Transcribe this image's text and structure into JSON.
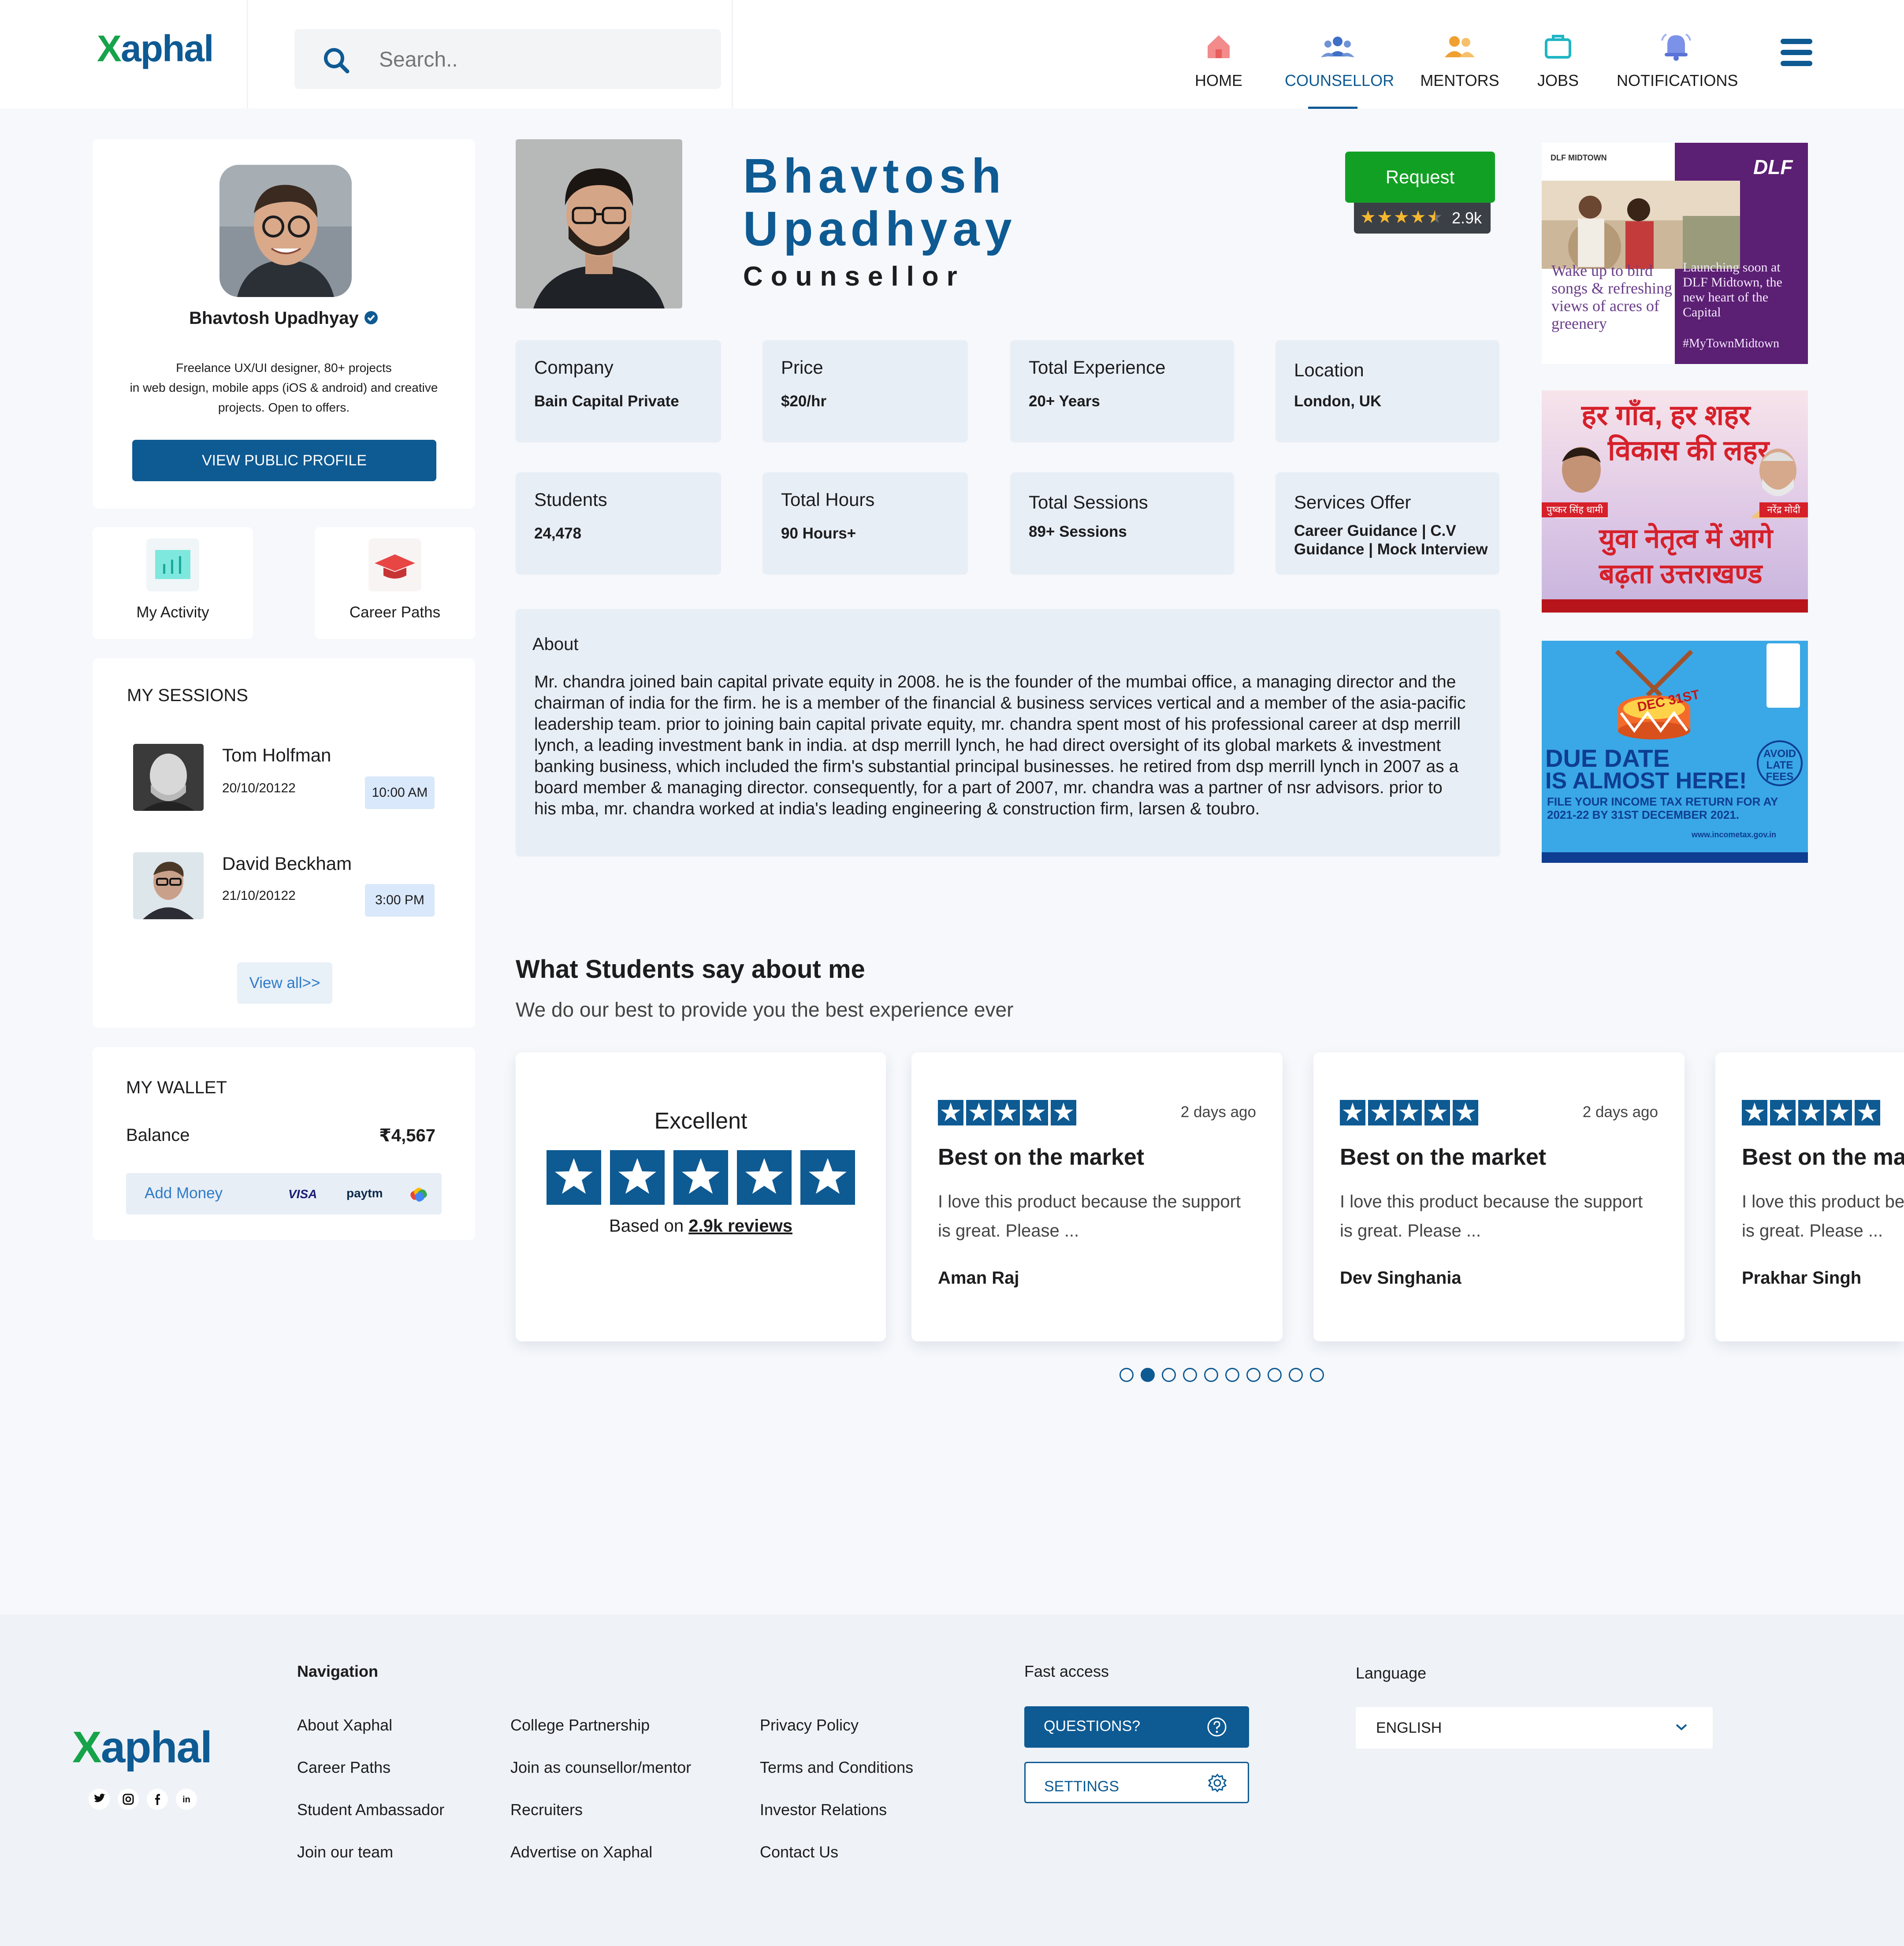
{
  "header": {
    "logo": {
      "x": "X",
      "rest": "aphal"
    },
    "search_placeholder": "Search..",
    "nav": [
      {
        "label": "HOME",
        "icon": "home-icon"
      },
      {
        "label": "COUNSELLOR",
        "icon": "counsellor-icon",
        "active": true
      },
      {
        "label": "MENTORS",
        "icon": "mentors-icon"
      },
      {
        "label": "JOBS",
        "icon": "jobs-icon"
      },
      {
        "label": "NOTIFICATIONS",
        "icon": "notifications-icon"
      }
    ],
    "menu_icon": "hamburger-menu-icon"
  },
  "sidebar": {
    "profile": {
      "name": "Bhavtosh Upadhyay",
      "bio_line1": "Freelance UX/UI designer, 80+ projects",
      "bio_line2": "in web design, mobile apps (iOS & android) and creative",
      "bio_line3": "projects. Open to offers.",
      "view_button": "VIEW PUBLIC PROFILE"
    },
    "tiles": [
      {
        "label": "My Activity",
        "icon": "activity-chart-icon"
      },
      {
        "label": "Career Paths",
        "icon": "graduation-cap-icon"
      }
    ],
    "sessions": {
      "title": "MY SESSIONS",
      "items": [
        {
          "name": "Tom Holfman",
          "date": "20/10/20122",
          "time": "10:00 AM"
        },
        {
          "name": "David Beckham",
          "date": "21/10/20122",
          "time": "3:00 PM"
        }
      ],
      "view_all": "View all>>"
    },
    "wallet": {
      "title": "MY WALLET",
      "balance_label": "Balance",
      "balance_value": "₹4,567",
      "add_money": "Add Money",
      "payment_logos": [
        "VISA",
        "paytm"
      ]
    }
  },
  "profile": {
    "first_name": "Bhavtosh",
    "last_name": "Upadhyay",
    "role": "Counsellor",
    "request_button": "Request",
    "rating_count": "2.9k",
    "rating_stars": 4.5,
    "info": [
      {
        "label": "Company",
        "value": "Bain Capital Private"
      },
      {
        "label": "Price",
        "value": "$20/hr"
      },
      {
        "label": "Total Experience",
        "value": "20+ Years"
      },
      {
        "label": "Location",
        "value": "London, UK"
      },
      {
        "label": "Students",
        "value": "24,478"
      },
      {
        "label": "Total Hours",
        "value": "90 Hours+"
      },
      {
        "label": "Total Sessions",
        "value": "89+ Sessions"
      },
      {
        "label": "Services Offer",
        "value": "Career Guidance | C.V Guidance | Mock Interview"
      }
    ],
    "about_title": "About",
    "about_text": "Mr. chandra joined bain capital private equity in 2008. he is the founder of the mumbai office, a managing director and the chairman of india for the firm. he is a member of the financial & business services vertical and a member of the asia-pacific leadership team. prior to joining bain capital private equity, mr. chandra spent most of his professional career at dsp merrill lynch, a leading investment bank in india. at dsp merrill lynch, he had direct oversight of its global markets & investment banking business, which included the firm's substantial principal businesses. he retired from dsp merrill lynch in 2007 as a board member & managing director. consequently, for a part of 2007, mr. chandra was a partner of nsr advisors. prior to his mba, mr. chandra worked at india's leading engineering & construction firm, larsen & toubro."
  },
  "ads": [
    {
      "brand_small": "DLF MIDTOWN",
      "brand": "DLF",
      "left_text": "Wake up to bird songs & refreshing views of acres of greenery",
      "right_text": "Launching soon at DLF Midtown, the new heart of the Capital",
      "tag": "#MyTownMidtown"
    },
    {
      "headline1": "हर गाँव, हर शहर",
      "headline2": "विकास की लहर",
      "person1": "पुष्कर सिंह धामी",
      "person2": "नरेंद्र मोदी",
      "slogan1": "युवा नेतृत्व में आगे",
      "slogan2": "बढ़ता उत्तराखण्ड"
    },
    {
      "date_badge": "DEC 31ST",
      "headline1": "DUE DATE",
      "headline2": "IS ALMOST HERE!",
      "avoid": "AVOID LATE FEES",
      "subline": "FILE YOUR INCOME TAX RETURN FOR AY 2021-22 BY 31ST DECEMBER 2021.",
      "site": "www.incometax.gov.in"
    }
  ],
  "reviews": {
    "title": "What Students say about me",
    "subtitle": "We do our best to provide you the best experience ever",
    "summary": {
      "label": "Excellent",
      "based_on": "Based on",
      "reviews_link": "2.9k reviews",
      "stars": 5
    },
    "items": [
      {
        "time": "2 days ago",
        "title": "Best on the market",
        "text1": "I love this product because the support",
        "text2": "is great. Please ...",
        "author": "Aman Raj",
        "stars": 5
      },
      {
        "time": "2 days ago",
        "title": "Best on the market",
        "text1": "I love this product because the support",
        "text2": "is great. Please ...",
        "author": "Dev Singhania",
        "stars": 5
      },
      {
        "time": "",
        "title": "Best on the market",
        "text1": "I love this product because the support",
        "text2": "is great. Please ...",
        "author": "Prakhar Singh",
        "stars": 5
      }
    ],
    "pagination": {
      "total": 10,
      "active": 2
    }
  },
  "footer": {
    "navigation_title": "Navigation",
    "col1": [
      "About Xaphal",
      "Career Paths",
      "Student Ambassador",
      "Join our team"
    ],
    "col2": [
      "College Partnership",
      "Join as counsellor/mentor",
      "Recruiters",
      "Advertise on Xaphal"
    ],
    "col3": [
      "Privacy Policy",
      "Terms and Conditions",
      "Investor Relations",
      "Contact Us"
    ],
    "fast_access_title": "Fast access",
    "questions_button": "QUESTIONS?",
    "settings_button": "SETTINGS",
    "language_title": "Language",
    "language_value": "ENGLISH",
    "social": [
      "twitter-icon",
      "instagram-icon",
      "facebook-icon",
      "linkedin-icon"
    ]
  },
  "colors": {
    "brand": "#0e5a93",
    "accent_green": "#17a34a",
    "request_green": "#12a024",
    "bg": "#f6f8fb",
    "info_bg": "#e8eef6"
  }
}
